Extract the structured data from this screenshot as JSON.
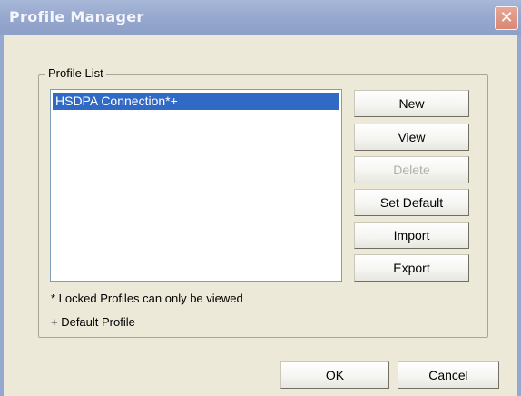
{
  "window": {
    "title": "Profile Manager",
    "close_glyph": "✕"
  },
  "profile_list": {
    "group_label": "Profile List",
    "items": [
      {
        "label": "HSDPA Connection*+",
        "selected": true
      }
    ]
  },
  "actions": {
    "new_label": "New",
    "view_label": "View",
    "delete_label": "Delete",
    "delete_enabled": false,
    "set_default_label": "Set Default",
    "import_label": "Import",
    "export_label": "Export"
  },
  "notes": {
    "locked": "* Locked Profiles can only be viewed",
    "default": "+ Default Profile"
  },
  "footer": {
    "ok_label": "OK",
    "cancel_label": "Cancel"
  },
  "colors": {
    "title_bar": "#98a9cf",
    "selection": "#316ac5",
    "dialog_bg": "#ece9d8"
  }
}
